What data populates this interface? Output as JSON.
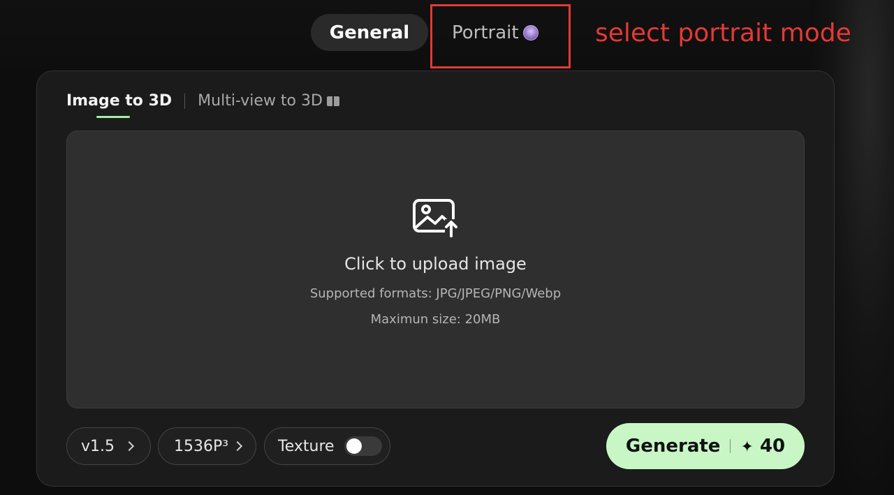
{
  "mode_tabs": {
    "general": "General",
    "portrait": "Portrait"
  },
  "annotation": "select portrait mode",
  "sub_tabs": {
    "image_to_3d": "Image to 3D",
    "multi_view": "Multi-view to 3D"
  },
  "upload": {
    "title": "Click to upload image",
    "formats": "Supported formats: JPG/JPEG/PNG/Webp",
    "max_size": "Maximun size: 20MB"
  },
  "controls": {
    "version": "v1.5",
    "resolution": "1536P³",
    "texture_label": "Texture",
    "texture_enabled": false
  },
  "generate": {
    "label": "Generate",
    "credits": "40"
  },
  "colors": {
    "accent_green": "#c8f7c5",
    "annotation_red": "#e53935",
    "tab_underline": "#9ff2a3"
  },
  "icons": [
    "portrait-avatar-icon",
    "book-icon",
    "image-upload-icon",
    "chevron-right-icon",
    "sparkle-icon"
  ]
}
